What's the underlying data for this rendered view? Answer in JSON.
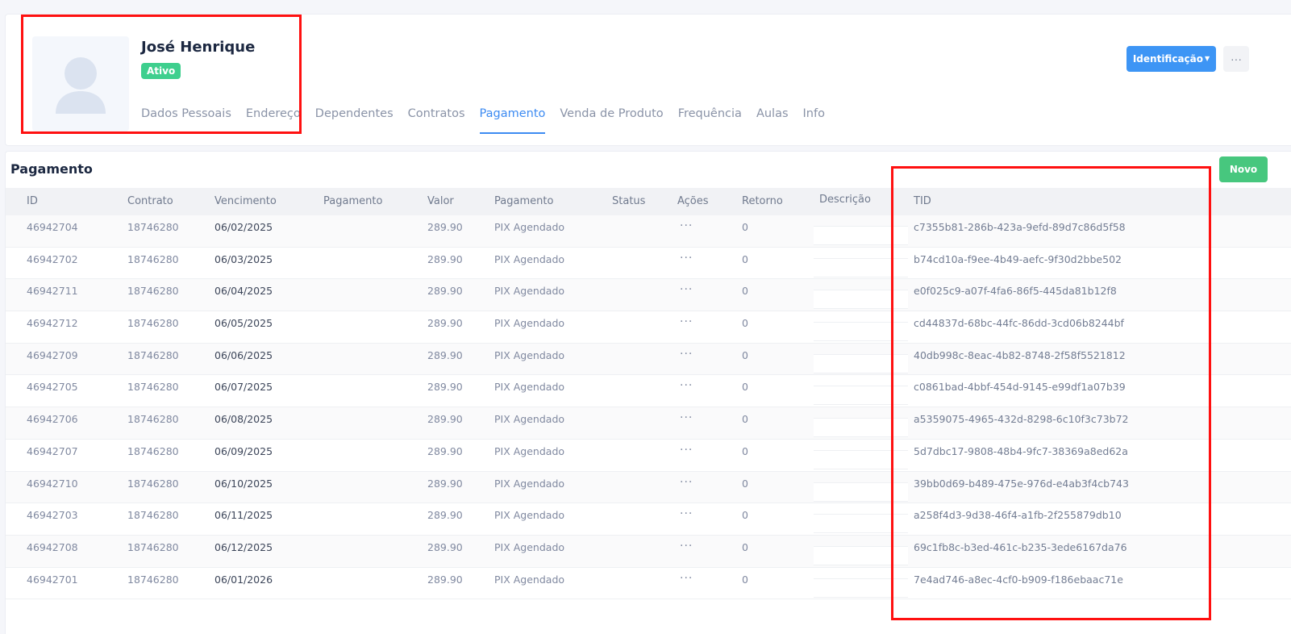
{
  "profile": {
    "name": "José Henrique",
    "status": "Ativo",
    "avatar_icon": "user-silhouette-icon"
  },
  "tabs": [
    {
      "label": "Dados Pessoais",
      "active": false
    },
    {
      "label": "Endereço",
      "active": false
    },
    {
      "label": "Dependentes",
      "active": false
    },
    {
      "label": "Contratos",
      "active": false
    },
    {
      "label": "Pagamento",
      "active": true
    },
    {
      "label": "Venda de Produto",
      "active": false
    },
    {
      "label": "Frequência",
      "active": false
    },
    {
      "label": "Aulas",
      "active": false
    },
    {
      "label": "Info",
      "active": false
    }
  ],
  "toolbar": {
    "identification_label": "Identificação",
    "more_label": "···"
  },
  "payments": {
    "title": "Pagamento",
    "new_label": "Novo",
    "columns": [
      "ID",
      "Contrato",
      "Vencimento",
      "Pagamento",
      "Valor",
      "Pagamento",
      "Status",
      "Ações",
      "Retorno",
      "Descrição",
      "TID"
    ],
    "rows": [
      {
        "id": "46942704",
        "contrato": "18746280",
        "vencimento": "06/02/2025",
        "pagamento_data": "",
        "valor": "289.90",
        "forma": "PIX Agendado",
        "status": "",
        "acoes": "···",
        "retorno": "0",
        "descricao": "",
        "tid": "c7355b81-286b-423a-9efd-89d7c86d5f58"
      },
      {
        "id": "46942702",
        "contrato": "18746280",
        "vencimento": "06/03/2025",
        "pagamento_data": "",
        "valor": "289.90",
        "forma": "PIX Agendado",
        "status": "",
        "acoes": "···",
        "retorno": "0",
        "descricao": "",
        "tid": "b74cd10a-f9ee-4b49-aefc-9f30d2bbe502"
      },
      {
        "id": "46942711",
        "contrato": "18746280",
        "vencimento": "06/04/2025",
        "pagamento_data": "",
        "valor": "289.90",
        "forma": "PIX Agendado",
        "status": "",
        "acoes": "···",
        "retorno": "0",
        "descricao": "",
        "tid": "e0f025c9-a07f-4fa6-86f5-445da81b12f8"
      },
      {
        "id": "46942712",
        "contrato": "18746280",
        "vencimento": "06/05/2025",
        "pagamento_data": "",
        "valor": "289.90",
        "forma": "PIX Agendado",
        "status": "",
        "acoes": "···",
        "retorno": "0",
        "descricao": "",
        "tid": "cd44837d-68bc-44fc-86dd-3cd06b8244bf"
      },
      {
        "id": "46942709",
        "contrato": "18746280",
        "vencimento": "06/06/2025",
        "pagamento_data": "",
        "valor": "289.90",
        "forma": "PIX Agendado",
        "status": "",
        "acoes": "···",
        "retorno": "0",
        "descricao": "",
        "tid": "40db998c-8eac-4b82-8748-2f58f5521812"
      },
      {
        "id": "46942705",
        "contrato": "18746280",
        "vencimento": "06/07/2025",
        "pagamento_data": "",
        "valor": "289.90",
        "forma": "PIX Agendado",
        "status": "",
        "acoes": "···",
        "retorno": "0",
        "descricao": "",
        "tid": "c0861bad-4bbf-454d-9145-e99df1a07b39"
      },
      {
        "id": "46942706",
        "contrato": "18746280",
        "vencimento": "06/08/2025",
        "pagamento_data": "",
        "valor": "289.90",
        "forma": "PIX Agendado",
        "status": "",
        "acoes": "···",
        "retorno": "0",
        "descricao": "",
        "tid": "a5359075-4965-432d-8298-6c10f3c73b72"
      },
      {
        "id": "46942707",
        "contrato": "18746280",
        "vencimento": "06/09/2025",
        "pagamento_data": "",
        "valor": "289.90",
        "forma": "PIX Agendado",
        "status": "",
        "acoes": "···",
        "retorno": "0",
        "descricao": "",
        "tid": "5d7dbc17-9808-48b4-9fc7-38369a8ed62a"
      },
      {
        "id": "46942710",
        "contrato": "18746280",
        "vencimento": "06/10/2025",
        "pagamento_data": "",
        "valor": "289.90",
        "forma": "PIX Agendado",
        "status": "",
        "acoes": "···",
        "retorno": "0",
        "descricao": "",
        "tid": "39bb0d69-b489-475e-976d-e4ab3f4cb743"
      },
      {
        "id": "46942703",
        "contrato": "18746280",
        "vencimento": "06/11/2025",
        "pagamento_data": "",
        "valor": "289.90",
        "forma": "PIX Agendado",
        "status": "",
        "acoes": "···",
        "retorno": "0",
        "descricao": "",
        "tid": "a258f4d3-9d38-46f4-a1fb-2f255879db10"
      },
      {
        "id": "46942708",
        "contrato": "18746280",
        "vencimento": "06/12/2025",
        "pagamento_data": "",
        "valor": "289.90",
        "forma": "PIX Agendado",
        "status": "",
        "acoes": "···",
        "retorno": "0",
        "descricao": "",
        "tid": "69c1fb8c-b3ed-461c-b235-3ede6167da76"
      },
      {
        "id": "46942701",
        "contrato": "18746280",
        "vencimento": "06/01/2026",
        "pagamento_data": "",
        "valor": "289.90",
        "forma": "PIX Agendado",
        "status": "",
        "acoes": "···",
        "retorno": "0",
        "descricao": "",
        "tid": "7e4ad746-a8ec-4cf0-b909-f186ebaac71e"
      }
    ]
  },
  "colors": {
    "accent": "#3d95f5",
    "success": "#3ecf8e",
    "new_button": "#47c77e",
    "highlight": "#ff1010"
  }
}
